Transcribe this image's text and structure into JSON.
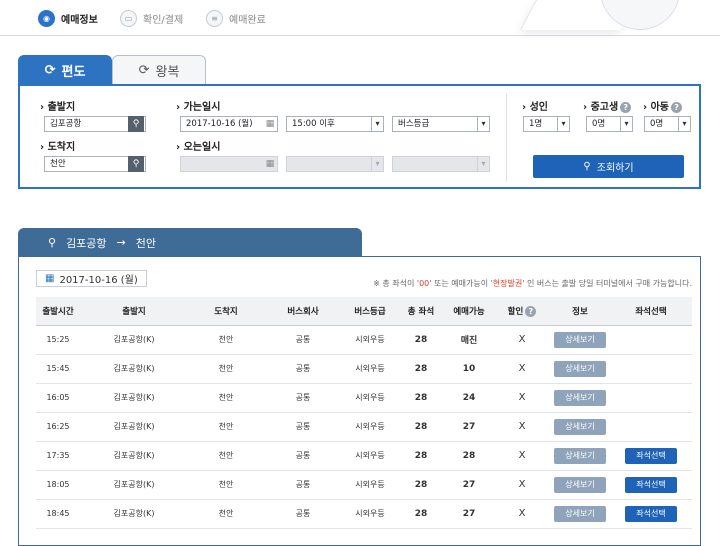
{
  "steps": [
    {
      "label": "예매정보",
      "active": true
    },
    {
      "label": "확인/결제",
      "active": false
    },
    {
      "label": "예매완료",
      "active": false
    }
  ],
  "tabs": {
    "oneway": "편도",
    "roundtrip": "왕복"
  },
  "search": {
    "departure_label": "출발지",
    "departure_value": "김포공항",
    "arrival_label": "도착지",
    "arrival_value": "천안",
    "go_date_label": "가는일시",
    "go_date_value": "2017-10-16 (월)",
    "go_time_value": "15:00 이후",
    "bus_grade_value": "버스등급",
    "return_date_label": "오는일시",
    "adult_label": "성인",
    "adult_value": "1명",
    "youth_label": "중고생",
    "youth_value": "0명",
    "child_label": "아동",
    "child_value": "0명",
    "inquiry_button": "조회하기"
  },
  "route": {
    "from": "김포공항",
    "to": "천안"
  },
  "results": {
    "date": "2017-10-16 (월)",
    "notice_prefix": "※ 총 좌석이 '",
    "notice_zero": "00",
    "notice_mid": "' 또는 예매가능이 '",
    "notice_onsite": "현장발권",
    "notice_suffix": "' 인 버스는 출발 당일 터미널에서 구매 가능합니다.",
    "columns": [
      "출발시간",
      "출발지",
      "도착지",
      "버스회사",
      "버스등급",
      "총 좌석",
      "예매가능",
      "할인",
      "정보",
      "좌석선택"
    ],
    "detail_label": "상세보기",
    "seat_label": "좌석선택",
    "rows": [
      {
        "time": "15:25",
        "from": "김포공항(K)",
        "to": "천안",
        "company": "공통",
        "grade": "시외우등",
        "total": "28",
        "available": "매진",
        "discount": "X",
        "seat": false
      },
      {
        "time": "15:45",
        "from": "김포공항(K)",
        "to": "천안",
        "company": "공통",
        "grade": "시외우등",
        "total": "28",
        "available": "10",
        "discount": "X",
        "seat": false
      },
      {
        "time": "16:05",
        "from": "김포공항(K)",
        "to": "천안",
        "company": "공통",
        "grade": "시외우등",
        "total": "28",
        "available": "24",
        "discount": "X",
        "seat": false
      },
      {
        "time": "16:25",
        "from": "김포공항(K)",
        "to": "천안",
        "company": "공통",
        "grade": "시외우등",
        "total": "28",
        "available": "27",
        "discount": "X",
        "seat": false
      },
      {
        "time": "17:35",
        "from": "김포공항(K)",
        "to": "천안",
        "company": "공통",
        "grade": "시외우등",
        "total": "28",
        "available": "28",
        "discount": "X",
        "seat": true
      },
      {
        "time": "18:05",
        "from": "김포공항(K)",
        "to": "천안",
        "company": "공통",
        "grade": "시외우등",
        "total": "28",
        "available": "27",
        "discount": "X",
        "seat": true
      },
      {
        "time": "18:45",
        "from": "김포공항(K)",
        "to": "천안",
        "company": "공통",
        "grade": "시외우등",
        "total": "28",
        "available": "27",
        "discount": "X",
        "seat": true
      }
    ]
  }
}
